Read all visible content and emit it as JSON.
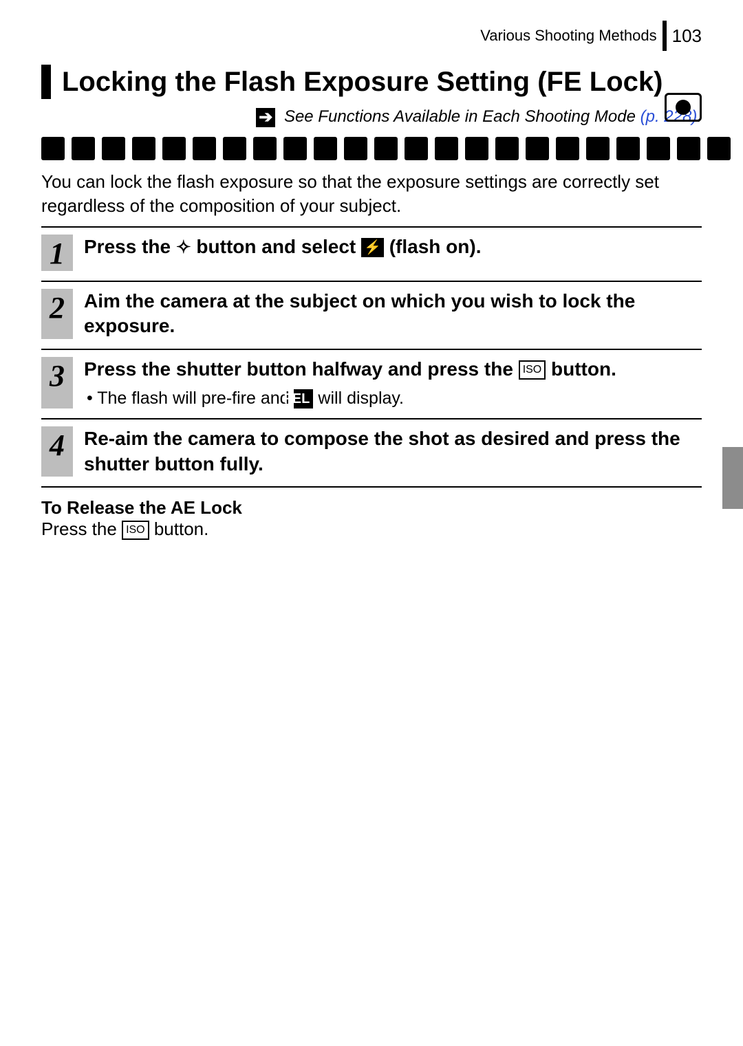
{
  "header": {
    "section": "Various Shooting Methods",
    "page_number": "103"
  },
  "title": "Locking the Flash Exposure Setting (FE Lock)",
  "see_also": {
    "arrow_glyph": "➔",
    "text": "See Functions Available in Each Shooting Mode",
    "link": "(p. 228)",
    "trailing": "."
  },
  "mode_icon_count": 23,
  "intro": "You can lock the flash exposure so that the exposure settings are correctly set regardless of the composition of your subject.",
  "steps": [
    {
      "num": "1",
      "title_pre": "Press the ",
      "flash_sym": "⯆",
      "title_mid": " button and select ",
      "flash_on_icon": "⚡",
      "title_post": " (flash on)."
    },
    {
      "num": "2",
      "title": "Aim the camera at the subject on which you wish to lock the exposure."
    },
    {
      "num": "3",
      "title_pre": "Press the shutter button halfway and press the ",
      "iso_label": "ISO",
      "title_post": " button.",
      "sub_pre": "The flash will pre-fire and ",
      "fel_label": "FEL",
      "sub_post": " will display."
    },
    {
      "num": "4",
      "title": "Re-aim the camera to compose the shot as desired and press the shutter button fully."
    }
  ],
  "release": {
    "title": "To Release the AE Lock",
    "body_pre": "Press the ",
    "iso_label": "ISO",
    "body_post": " button."
  }
}
